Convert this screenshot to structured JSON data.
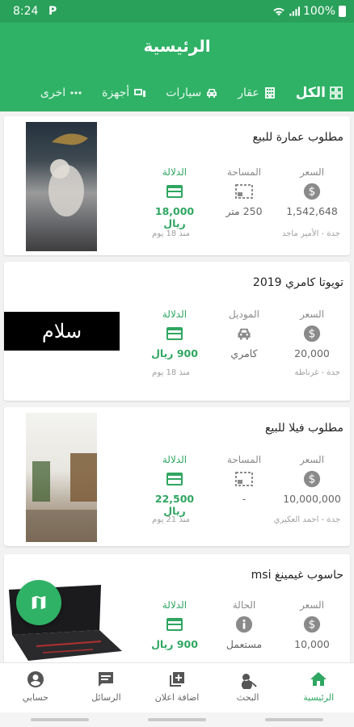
{
  "status_bar": {
    "time": "8:24",
    "notif_icon": "P",
    "battery": "100%"
  },
  "appbar": {
    "title": "الرئيسية"
  },
  "tabs": [
    {
      "label": "الكل",
      "icon": "grid-icon"
    },
    {
      "label": "عقار",
      "icon": "building-icon"
    },
    {
      "label": "سيارات",
      "icon": "car-icon"
    },
    {
      "label": "أجهزة",
      "icon": "devices-icon"
    },
    {
      "label": "اخرى",
      "icon": "more-horizontal-icon"
    }
  ],
  "cards": [
    {
      "title": "مطلوب عمارة للبيع",
      "c1": {
        "label": "السعر",
        "value": "1,542,648"
      },
      "c2": {
        "label": "المساحة",
        "value": "250 متر"
      },
      "c3": {
        "label": "الدلالة",
        "value": "18,000 ريال"
      },
      "meta": "جدة - الأمير ماجد",
      "ago": "منذ 18 يوم",
      "image": "curtain-photo"
    },
    {
      "title": "تويوتا كامري 2019",
      "c1": {
        "label": "السعر",
        "value": "20,000"
      },
      "c2": {
        "label": "الموديل",
        "value": "كامري"
      },
      "c3": {
        "label": "الدلالة",
        "value": "900 ريال"
      },
      "meta": "جدة - غرناطة",
      "ago": "منذ 18 يوم",
      "image_text": "سلام"
    },
    {
      "title": "مطلوب فيلا للبيع",
      "c1": {
        "label": "السعر",
        "value": "10,000,000"
      },
      "c2": {
        "label": "المساحة",
        "value": "-"
      },
      "c3": {
        "label": "الدلالة",
        "value": "22,500 ريال"
      },
      "meta": "جدة - احمد العكيري",
      "ago": "منذ 21 يوم",
      "image": "room-photo"
    },
    {
      "title": "حاسوب غيمينغ msi",
      "c1": {
        "label": "السعر",
        "value": "10,000"
      },
      "c2": {
        "label": "الحالة",
        "value": "مستعمل"
      },
      "c3": {
        "label": "الدلالة",
        "value": "900 ريال"
      },
      "image": "laptop-photo"
    }
  ],
  "bottom_nav": [
    {
      "label": "الرئيسية",
      "icon": "home-icon"
    },
    {
      "label": "البحث",
      "icon": "search-icon"
    },
    {
      "label": "اضافة اعلان",
      "icon": "add-box-icon"
    },
    {
      "label": "الرسائل",
      "icon": "chat-icon"
    },
    {
      "label": "حسابي",
      "icon": "account-icon"
    }
  ],
  "colors": {
    "primary": "#2fb266",
    "accent_text": "#2fa661",
    "status_bar": "#2aa15b"
  }
}
